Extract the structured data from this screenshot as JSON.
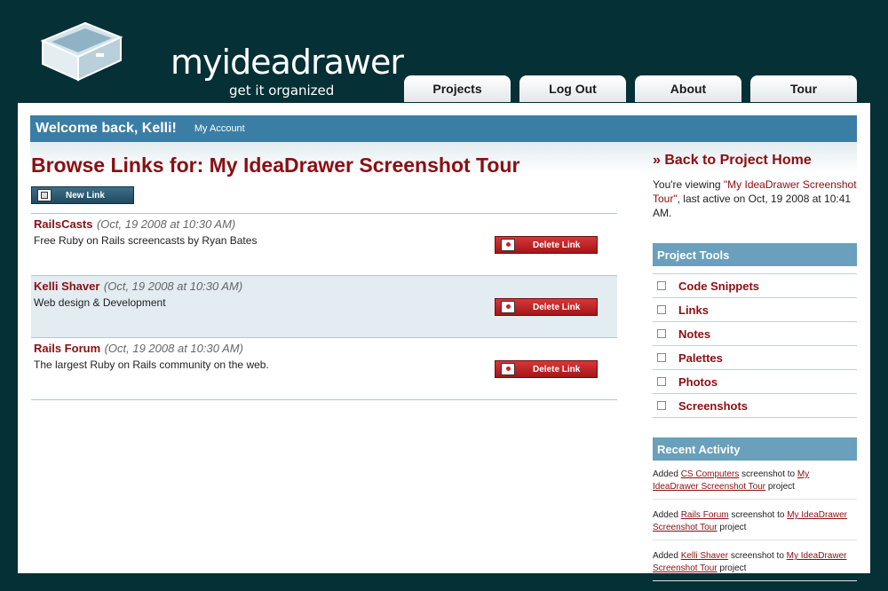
{
  "logo": {
    "name": "myideadrawer",
    "tagline": "get it organized"
  },
  "nav": {
    "tabs": [
      {
        "label": "Projects"
      },
      {
        "label": "Log Out"
      },
      {
        "label": "About"
      },
      {
        "label": "Tour"
      }
    ]
  },
  "welcome": {
    "greeting": "Welcome back, Kelli!",
    "account_link": "My Account"
  },
  "main": {
    "title": "Browse Links for: My IdeaDrawer Screenshot Tour",
    "new_link_label": "New Link",
    "delete_label": "Delete Link",
    "links": [
      {
        "name": "RailsCasts",
        "date": "(Oct, 19 2008 at 10:30 AM)",
        "description": "Free Ruby on Rails screencasts by Ryan Bates"
      },
      {
        "name": "Kelli Shaver",
        "date": "(Oct, 19 2008 at 10:30 AM)",
        "description": "Web design & Development"
      },
      {
        "name": "Rails Forum",
        "date": "(Oct, 19 2008 at 10:30 AM)",
        "description": "The largest Ruby on Rails community on the web."
      }
    ]
  },
  "sidebar": {
    "back_link": "» Back to Project Home",
    "viewing": {
      "prefix": "You're viewing ",
      "project": "\"My IdeaDrawer Screenshot Tour\"",
      "suffix": ", last active on Oct, 19 2008 at 10:41 AM."
    },
    "tools_title": "Project Tools",
    "tools": [
      {
        "label": "Code Snippets"
      },
      {
        "label": "Links"
      },
      {
        "label": "Notes"
      },
      {
        "label": "Palettes"
      },
      {
        "label": "Photos"
      },
      {
        "label": "Screenshots"
      }
    ],
    "activity_title": "Recent Activity",
    "activity": [
      {
        "prefix": "Added ",
        "item": "CS Computers",
        "middle": " screenshot to ",
        "project": "My IdeaDrawer Screenshot Tour",
        "suffix": " project"
      },
      {
        "prefix": "Added ",
        "item": "Rails Forum",
        "middle": " screenshot to ",
        "project": "My IdeaDrawer Screenshot Tour",
        "suffix": " project"
      },
      {
        "prefix": "Added ",
        "item": "Kelli Shaver",
        "middle": " screenshot to ",
        "project": "My IdeaDrawer Screenshot Tour",
        "suffix": " project"
      }
    ]
  },
  "colors": {
    "background": "#043036",
    "accent_blue": "#3a7ea5",
    "link_red": "#8b0e12",
    "delete_button": "#c0262a"
  }
}
